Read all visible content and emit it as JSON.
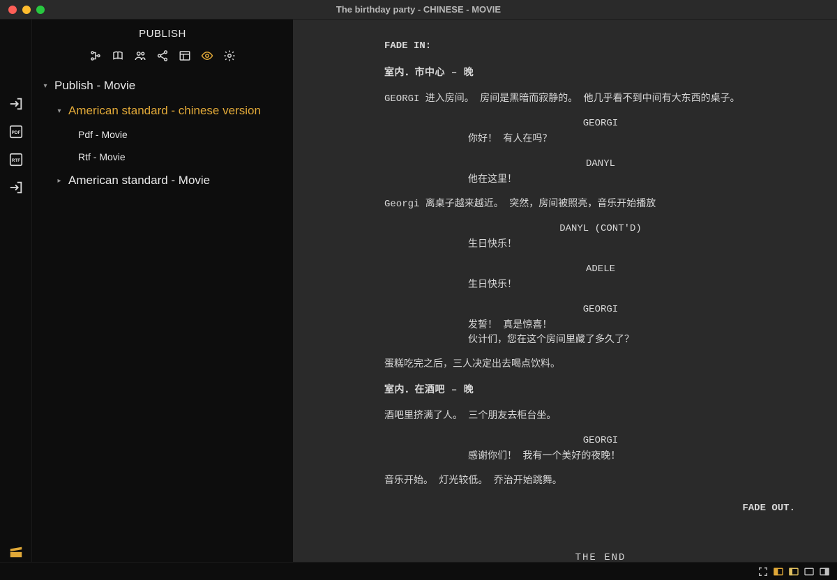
{
  "window": {
    "title": "The birthday party - CHINESE - MOVIE"
  },
  "sidebar": {
    "header": "PUBLISH",
    "tree": {
      "root": "Publish - Movie",
      "group1": "American standard - chinese version",
      "pdf": "Pdf - Movie",
      "rtf": "Rtf - Movie",
      "group2": "American standard - Movie"
    }
  },
  "script": {
    "fade_in": "FADE IN:",
    "scene1_heading": "室内．市中心 – 晚",
    "scene1_action1": "GEORGI 进入房间。 房间是黑暗而寂静的。 他几乎看不到中间有大东西的桌子。",
    "char_georgi": "GEORGI",
    "dlg_georgi1": "你好！ 有人在吗？",
    "char_danyl": "DANYL",
    "dlg_danyl1": "他在这里！",
    "scene1_action2": "Georgi 离桌子越来越近。 突然，房间被照亮，音乐开始播放",
    "char_danyl_contd": "DANYL (CONT'D)",
    "dlg_danyl2": "生日快乐！",
    "char_adele": "ADELE",
    "dlg_adele1": "生日快乐！",
    "dlg_georgi2_l1": "发誓！ 真是惊喜！",
    "dlg_georgi2_l2": "伙计们，您在这个房间里藏了多久了？",
    "scene1_action3": "蛋糕吃完之后，三人决定出去喝点饮料。",
    "scene2_heading": "室内．在酒吧 – 晚",
    "scene2_action1": "酒吧里挤满了人。 三个朋友去柜台坐。",
    "dlg_georgi3": "感谢你们！ 我有一个美好的夜晚！",
    "scene2_action2": "音乐开始。 灯光较低。 乔治开始跳舞。",
    "fade_out": "FADE OUT.",
    "the_end": "THE END"
  }
}
